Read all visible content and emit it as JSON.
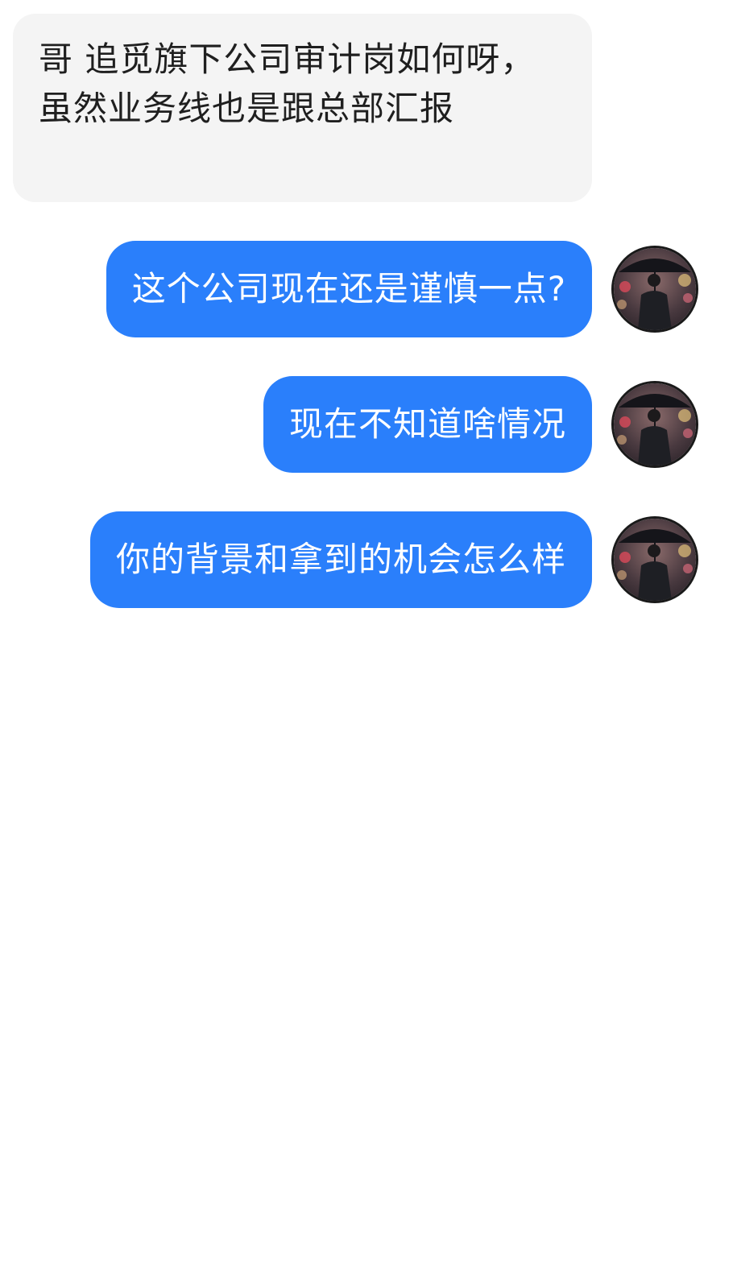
{
  "messages": [
    {
      "direction": "incoming",
      "text": "哥 追觅旗下公司审计岗如何呀，虽然业务线也是跟总部汇报"
    },
    {
      "direction": "outgoing",
      "text": "这个公司现在还是谨慎一点?"
    },
    {
      "direction": "outgoing",
      "text": "现在不知道啥情况"
    },
    {
      "direction": "outgoing",
      "text": "你的背景和拿到的机会怎么样"
    }
  ],
  "avatar": {
    "icon": "user-avatar-icon"
  },
  "colors": {
    "incoming_bubble": "#f4f4f4",
    "outgoing_bubble": "#2a7ffb",
    "background": "#ffffff"
  }
}
